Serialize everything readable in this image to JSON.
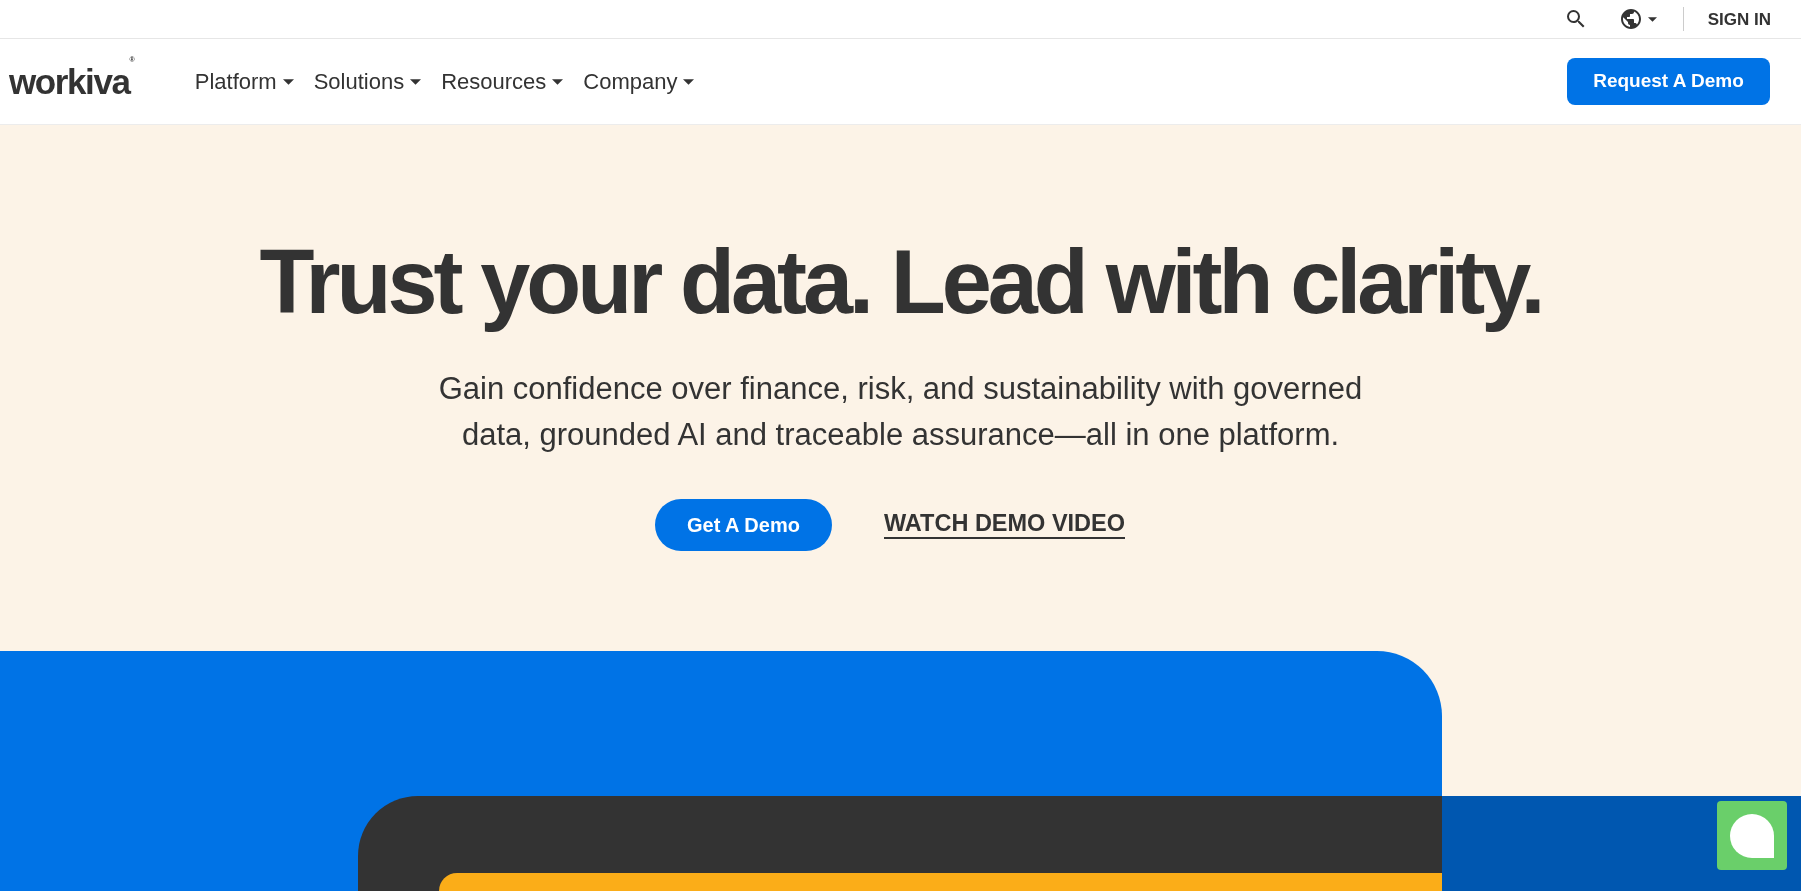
{
  "utility_bar": {
    "sign_in": "SIGN IN"
  },
  "nav": {
    "logo": "workiva$^{®}$",
    "items": [
      {
        "label": "Platform"
      },
      {
        "label": "Solutions"
      },
      {
        "label": "Resources"
      },
      {
        "label": "Company"
      }
    ],
    "cta": "Request A Demo"
  },
  "hero": {
    "title": "Trust your data. Lead with clarity.",
    "subtitle": "Gain confidence over finance, risk, and sustainability with governed data, grounded AI and traceable assurance—all in one platform.",
    "primary_button": "Get A Demo",
    "secondary_link": "WATCH DEMO VIDEO"
  }
}
